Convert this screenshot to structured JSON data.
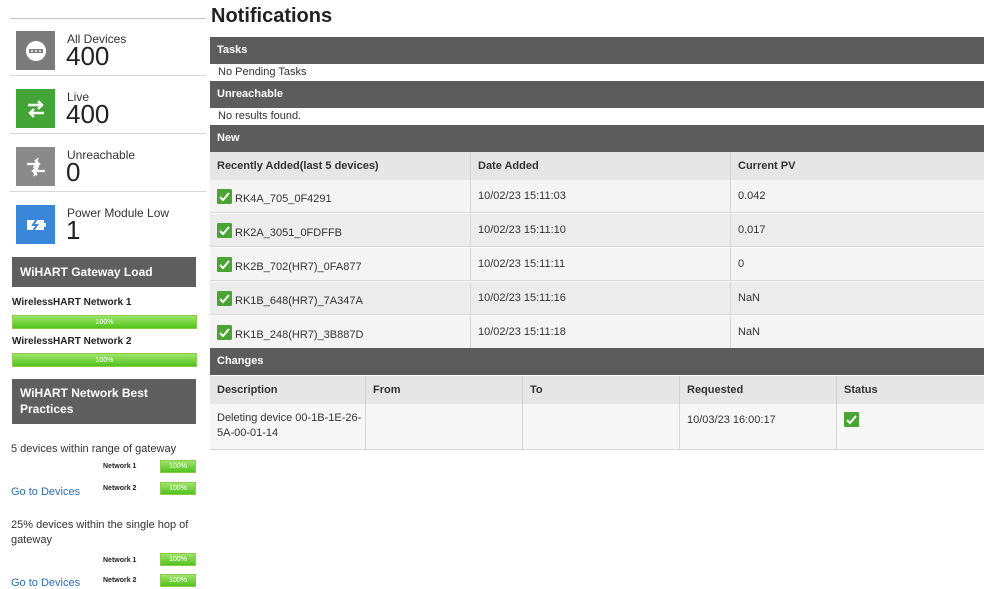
{
  "sidebar": {
    "cards": [
      {
        "label": "All Devices",
        "count": "400",
        "color": "#7b7b7b",
        "icon": "all-devices-icon"
      },
      {
        "label": "Live",
        "count": "400",
        "color": "#43a535",
        "icon": "live-arrows-icon"
      },
      {
        "label": "Unreachable",
        "count": "0",
        "color": "#8a8a8a",
        "icon": "unreachable-icon"
      },
      {
        "label": "Power Module Low",
        "count": "1",
        "color": "#3a86d8",
        "icon": "battery-low-icon"
      }
    ],
    "gateway_load": {
      "title": "WiHART Gateway Load",
      "networks": [
        {
          "name": "WirelessHART Network 1",
          "value_text": "100%",
          "fraction": 1.0
        },
        {
          "name": "WirelessHART Network 2",
          "value_text": "100%",
          "fraction": 1.0
        }
      ]
    },
    "best_practices": {
      "title": "WiHART Network Best Practices",
      "groups": [
        {
          "text": "5 devices within range of gateway",
          "link": "Go to Devices",
          "bars": [
            {
              "name": "Network 1",
              "value_text": "100%",
              "fraction": 1.0
            },
            {
              "name": "Network 2",
              "value_text": "100%",
              "fraction": 1.0
            }
          ]
        },
        {
          "text": "25% devices within the single hop of gateway",
          "link": "Go to Devices",
          "bars": [
            {
              "name": "Network 1",
              "value_text": "100%",
              "fraction": 1.0
            },
            {
              "name": "Network 2",
              "value_text": "100%",
              "fraction": 1.0
            }
          ]
        }
      ]
    }
  },
  "main": {
    "title": "Notifications",
    "tasks": {
      "header": "Tasks",
      "message": "No Pending Tasks"
    },
    "unreachable": {
      "header": "Unreachable",
      "message": "No results found."
    },
    "new": {
      "header": "New",
      "columns": [
        "Recently Added(last 5 devices)",
        "Date Added",
        "Current PV"
      ],
      "rows": [
        {
          "device": "RK4A_705_0F4291",
          "date": "10/02/23 15:11:03",
          "pv": "0.042"
        },
        {
          "device": "RK2A_3051_0FDFFB",
          "date": "10/02/23 15:11:10",
          "pv": "0.017"
        },
        {
          "device": "RK2B_702(HR7)_0FA877",
          "date": "10/02/23 15:11:11",
          "pv": "0"
        },
        {
          "device": "RK1B_648(HR7)_7A347A",
          "date": "10/02/23 15:11:16",
          "pv": "NaN"
        },
        {
          "device": "RK1B_248(HR7)_3B887D",
          "date": "10/02/23 15:11:18",
          "pv": "NaN"
        }
      ]
    },
    "changes": {
      "header": "Changes",
      "columns": [
        "Description",
        "From",
        "To",
        "Requested",
        "Status"
      ],
      "rows": [
        {
          "description": "Deleting device 00-1B-1E-26-5A-00-01-14",
          "from": "",
          "to": "",
          "requested": "10/03/23 16:00:17",
          "status": "check-icon"
        }
      ]
    }
  },
  "colors": {
    "header_bg": "#5c5c5c",
    "ok_green": "#4aa535",
    "bar_green": "#52c21c",
    "link": "#2a6ebb"
  }
}
